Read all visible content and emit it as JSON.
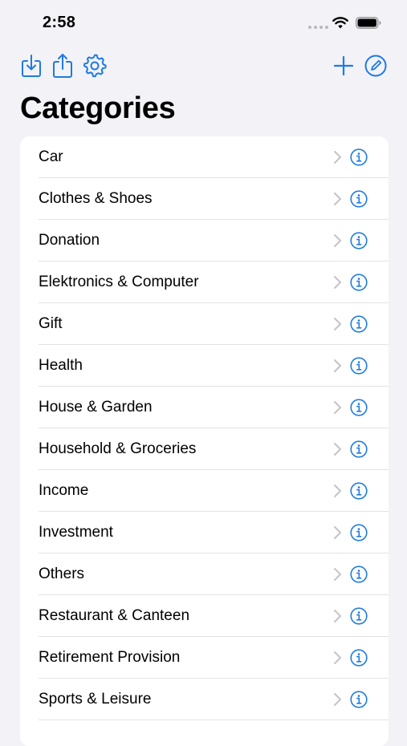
{
  "status_bar": {
    "time": "2:58"
  },
  "toolbar": {
    "left_icons": [
      "import-icon",
      "share-icon",
      "gear-icon"
    ],
    "right_icons": [
      "plus-icon",
      "edit-icon"
    ]
  },
  "accent_color": "#1E7BE0",
  "title": "Categories",
  "categories": [
    {
      "label": "Car"
    },
    {
      "label": "Clothes & Shoes"
    },
    {
      "label": "Donation"
    },
    {
      "label": "Elektronics & Computer"
    },
    {
      "label": "Gift"
    },
    {
      "label": "Health"
    },
    {
      "label": "House & Garden"
    },
    {
      "label": "Household & Groceries"
    },
    {
      "label": "Income"
    },
    {
      "label": "Investment"
    },
    {
      "label": "Others"
    },
    {
      "label": "Restaurant & Canteen"
    },
    {
      "label": "Retirement Provision"
    },
    {
      "label": "Sports & Leisure"
    }
  ]
}
